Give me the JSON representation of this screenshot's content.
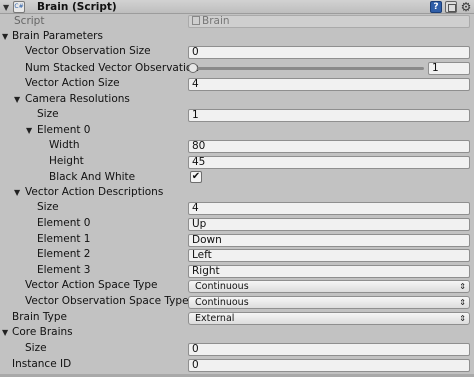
{
  "header": {
    "title": "Brain (Script)",
    "script_icon_text": "C#"
  },
  "script": {
    "label": "Script",
    "value": "Brain"
  },
  "brain_parameters": {
    "label": "Brain Parameters",
    "vector_observation_size": {
      "label": "Vector Observation Size",
      "value": "0"
    },
    "num_stacked": {
      "label": "Num Stacked Vector Observation",
      "value": "1",
      "slider_position": 0
    },
    "vector_action_size": {
      "label": "Vector Action Size",
      "value": "4"
    },
    "camera_resolutions": {
      "label": "Camera Resolutions",
      "size_label": "Size",
      "size_value": "1",
      "element_label": "Element 0",
      "width_label": "Width",
      "width_value": "80",
      "height_label": "Height",
      "height_value": "45",
      "bw_label": "Black And White",
      "bw_checked": "✔"
    },
    "vector_action_descriptions": {
      "label": "Vector Action Descriptions",
      "size_label": "Size",
      "size_value": "4",
      "elements": [
        {
          "label": "Element 0",
          "value": "Up"
        },
        {
          "label": "Element 1",
          "value": "Down"
        },
        {
          "label": "Element 2",
          "value": "Left"
        },
        {
          "label": "Element 3",
          "value": "Right"
        }
      ]
    },
    "vector_action_space_type": {
      "label": "Vector Action Space Type",
      "value": "Continuous"
    },
    "vector_observation_space_type": {
      "label": "Vector Observation Space Type",
      "value": "Continuous"
    }
  },
  "brain_type": {
    "label": "Brain Type",
    "value": "External"
  },
  "core_brains": {
    "label": "Core Brains",
    "size_label": "Size",
    "size_value": "0"
  },
  "instance_id": {
    "label": "Instance ID",
    "value": "0"
  }
}
